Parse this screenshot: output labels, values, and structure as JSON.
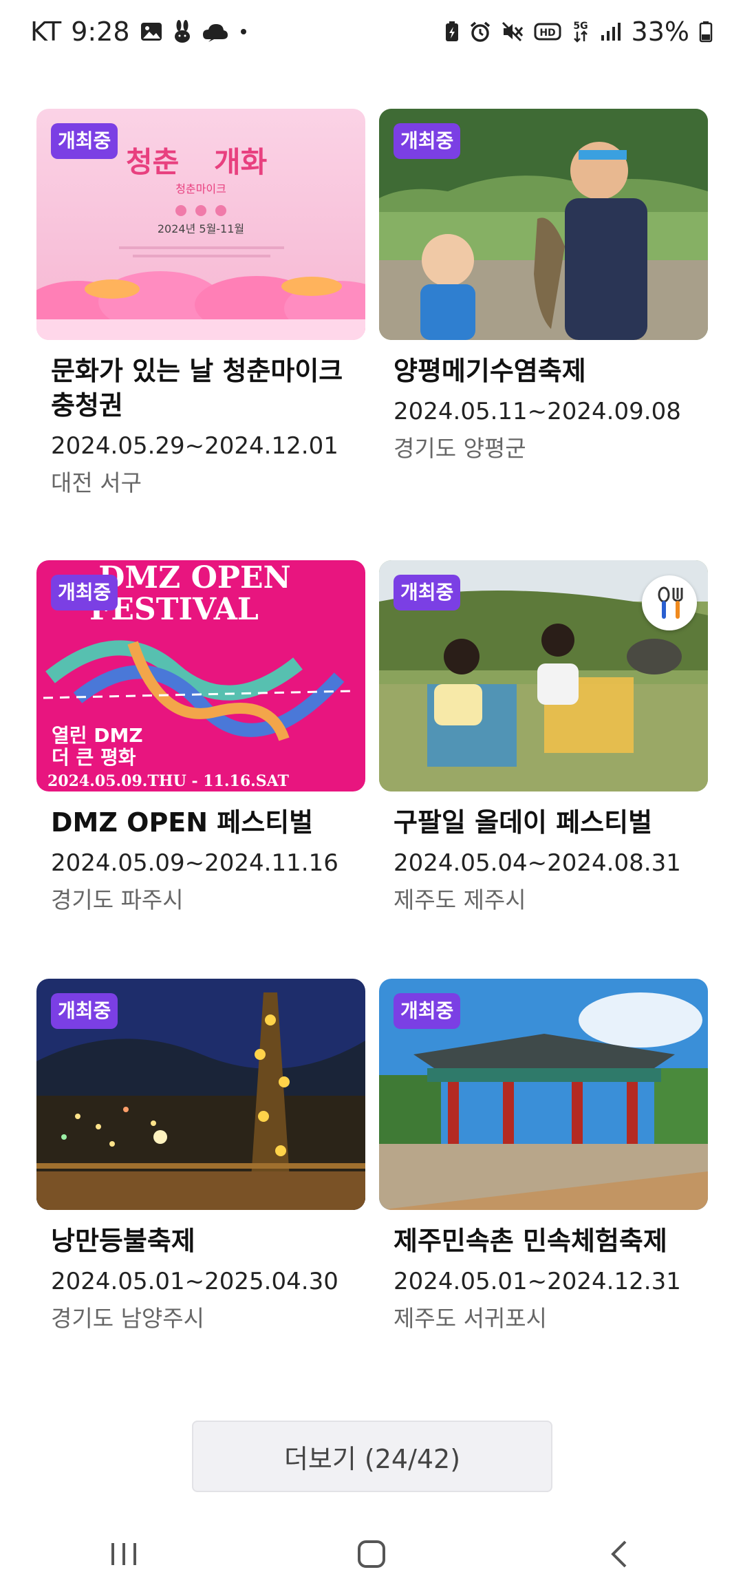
{
  "status_bar": {
    "carrier": "KT",
    "time": "9:28",
    "battery": "33%",
    "left_icons": [
      "image-icon",
      "rabbit-icon",
      "cloud-chat-icon",
      "dot-icon"
    ],
    "right_icons": [
      "battery-saver-icon",
      "alarm-icon",
      "mute-icon",
      "hd-icon",
      "5g-icon",
      "signal-icon",
      "battery-icon"
    ]
  },
  "badge_label": "개최중",
  "festivals": [
    {
      "title": "문화가 있는 날 청춘마이크 충청권",
      "dates": "2024.05.29~2024.12.01",
      "region": "대전 서구",
      "poster_text": [
        "청춘",
        "개화",
        "청춘마이크",
        "2024년 5월-11월"
      ]
    },
    {
      "title": "양평메기수염축제",
      "dates": "2024.05.11~2024.09.08",
      "region": "경기도 양평군"
    },
    {
      "title": "DMZ OPEN 페스티벌",
      "dates": "2024.05.09~2024.11.16",
      "region": "경기도 파주시",
      "poster_text": [
        "DMZ OPEN",
        "FESTIVAL",
        "열린 DMZ",
        "더 큰 평화",
        "2024.05.09.THU - 11.16.SAT"
      ]
    },
    {
      "title": "구팔일 올데이 페스티벌",
      "dates": "2024.05.04~2024.08.31",
      "region": "제주도 제주시",
      "has_food_icon": true
    },
    {
      "title": "낭만등불축제",
      "dates": "2024.05.01~2025.04.30",
      "region": "경기도 남양주시"
    },
    {
      "title": "제주민속촌 민속체험축제",
      "dates": "2024.05.01~2024.12.31",
      "region": "제주도 서귀포시"
    }
  ],
  "more_button": "더보기 (24/42)",
  "nav": [
    "recent-apps-button",
    "home-button",
    "back-button"
  ],
  "colors": {
    "badge": "#7b3fe4",
    "more_button_bg": "#f1f1f4"
  }
}
